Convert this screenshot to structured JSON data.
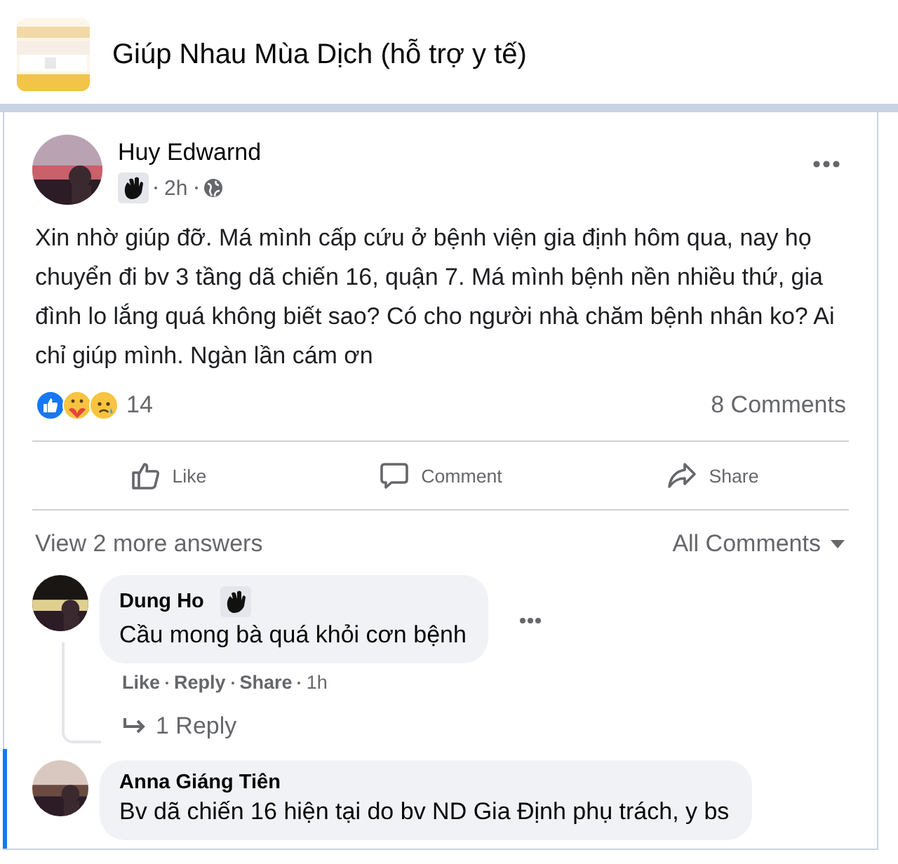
{
  "group": {
    "title": "Giúp Nhau Mùa Dịch (hỗ trợ y tế)"
  },
  "post": {
    "author": "Huy Edwarnd",
    "time": "2h",
    "text": "Xin nhờ giúp đỡ. Má mình cấp cứu ở bệnh viện gia định hôm qua, nay họ chuyển đi bv 3 tầng dã chiến 16, quận 7. Má mình bệnh nền nhiều thứ, gia đình lo lắng quá không biết sao? Có cho người nhà chăm bệnh nhân ko? Ai chỉ giúp mình. Ngàn lần cám ơn",
    "reaction_count": "14",
    "comment_count": "8 Comments",
    "actions": [
      {
        "kind": "like",
        "label": "Like"
      },
      {
        "kind": "comment",
        "label": "Comment"
      },
      {
        "kind": "share",
        "label": "Share"
      }
    ]
  },
  "comments_bar": {
    "more": "View 2 more answers",
    "sort": "All Comments"
  },
  "comments": [
    {
      "author": "Dung Ho",
      "badge": true,
      "highlighted": false,
      "text": "Cầu mong bà quá khỏi cơn bệnh",
      "links": [
        "Like",
        "Reply",
        "Share"
      ],
      "time": "1h",
      "replies": "1 Reply"
    },
    {
      "author": "Anna Giáng Tiên",
      "badge": false,
      "highlighted": true,
      "text": "Bv dã chiến 16 hiện tại do bv ND Gia Định phụ trách, y bs"
    }
  ]
}
